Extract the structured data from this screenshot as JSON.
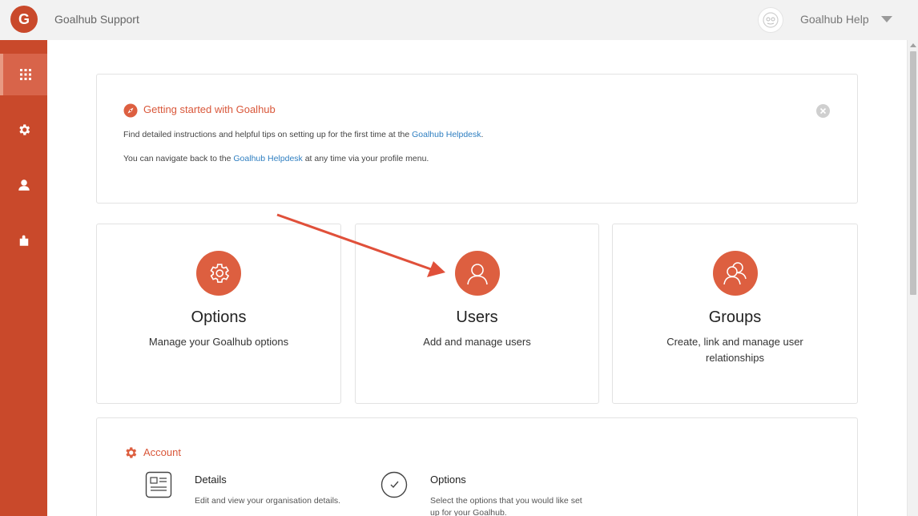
{
  "header": {
    "logo_letter": "G",
    "app_title": "Goalhub Support",
    "profile_name": "Goalhub Help"
  },
  "sidebar": {
    "items": [
      {
        "icon": "apps-grid-icon",
        "active": true
      },
      {
        "icon": "gear-icon",
        "active": false
      },
      {
        "icon": "user-icon",
        "active": false
      },
      {
        "icon": "plugin-icon",
        "active": false
      }
    ]
  },
  "notice": {
    "title": "Getting started with Goalhub",
    "line1_prefix": "Find detailed instructions and helpful tips on setting up for the first time at the ",
    "line1_link": "Goalhub Helpdesk",
    "line1_suffix": ".",
    "line2_prefix": "You can navigate back to the ",
    "line2_link": "Goalhub Helpdesk",
    "line2_suffix": " at any time via your profile menu."
  },
  "tiles": [
    {
      "title": "Options",
      "subtitle": "Manage your Goalhub options",
      "icon": "gear-icon"
    },
    {
      "title": "Users",
      "subtitle": "Add and manage users",
      "icon": "user-icon"
    },
    {
      "title": "Groups",
      "subtitle": "Create, link and manage user relationships",
      "icon": "group-icon"
    }
  ],
  "account": {
    "title": "Account",
    "items": [
      {
        "title": "Details",
        "description": "Edit and view your organisation details.",
        "icon": "details-card-icon"
      },
      {
        "title": "Options",
        "description": "Select the options that you would like set up for your Goalhub.",
        "icon": "checkmark-circle-icon"
      }
    ]
  },
  "colors": {
    "brand": "#c9492b",
    "accent": "#dd5f40",
    "link": "#2f7fc1",
    "annotation_arrow": "#e0503a"
  }
}
